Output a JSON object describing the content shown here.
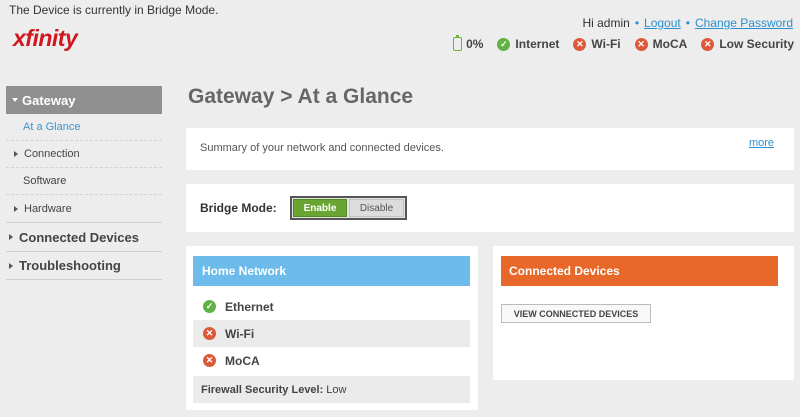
{
  "banner": "The Device is currently in Bridge Mode.",
  "logo": "xfinity",
  "user": {
    "greeting": "Hi admin",
    "separator": "•",
    "logout": "Logout",
    "change_password": "Change Password"
  },
  "status": {
    "battery": "0%",
    "internet": "Internet",
    "wifi": "Wi-Fi",
    "moca": "MoCA",
    "security": "Low Security"
  },
  "sidebar": {
    "section": "Gateway",
    "items": [
      "At a Glance",
      "Connection",
      "Software",
      "Hardware"
    ],
    "top_items": [
      "Connected Devices",
      "Troubleshooting"
    ]
  },
  "page_title": "Gateway > At a Glance",
  "summary": {
    "text": "Summary of your network and connected devices.",
    "more": "more"
  },
  "bridge_mode": {
    "label": "Bridge Mode:",
    "enable": "Enable",
    "disable": "Disable",
    "state": "Enable"
  },
  "home_network": {
    "title": "Home Network",
    "rows": [
      {
        "label": "Ethernet",
        "status": "ok"
      },
      {
        "label": "Wi-Fi",
        "status": "error"
      },
      {
        "label": "MoCA",
        "status": "error"
      }
    ],
    "firewall_label": "Firewall Security Level:",
    "firewall_value": "Low"
  },
  "connected_devices": {
    "title": "Connected Devices",
    "button": "VIEW CONNECTED DEVICES"
  },
  "colors": {
    "brand": "#d0161f",
    "link": "#2a8fd0",
    "ok": "#62b144",
    "error": "#dc5a3a",
    "home_header": "#6cbbeb",
    "devices_header": "#e8682a",
    "toggle_on": "#6aa533"
  }
}
